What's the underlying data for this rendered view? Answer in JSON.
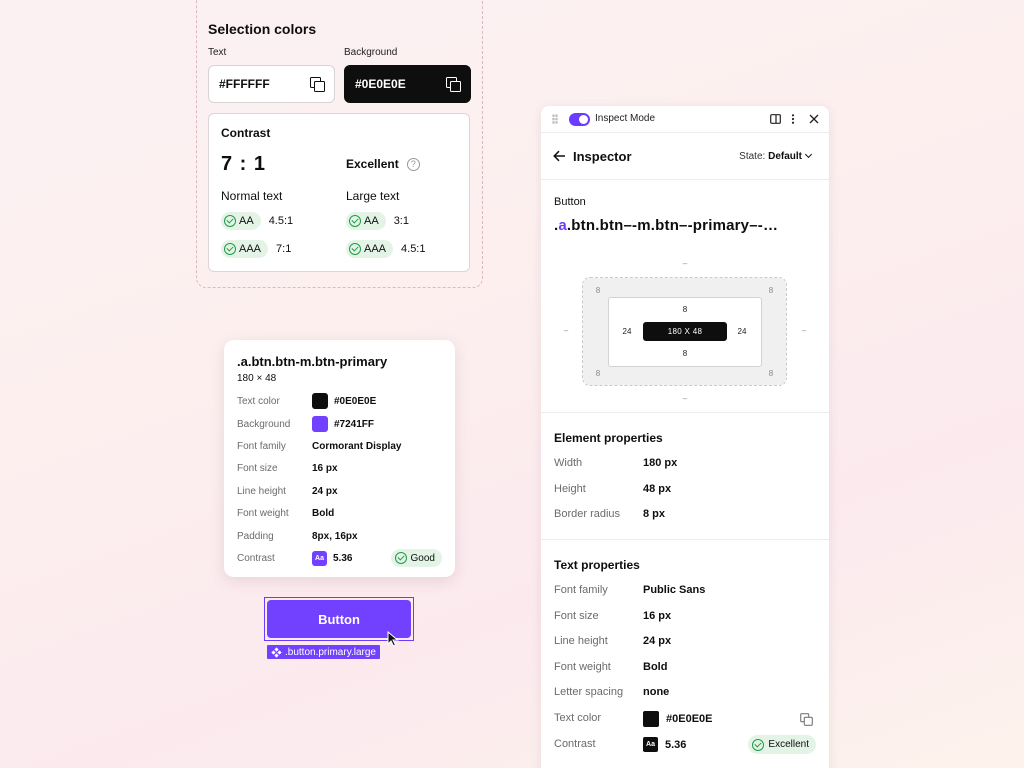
{
  "selection_colors": {
    "title": "Selection colors",
    "text_label": "Text",
    "text_value": "#FFFFFF",
    "background_label": "Background",
    "background_value": "#0E0E0E"
  },
  "contrast": {
    "title": "Contrast",
    "ratio": "7 : 1",
    "rating": "Excellent",
    "help_glyph": "?",
    "normal_label": "Normal text",
    "large_label": "Large text",
    "normal": [
      {
        "level": "AA",
        "value": "4.5:1"
      },
      {
        "level": "AAA",
        "value": "7:1"
      }
    ],
    "large": [
      {
        "level": "AA",
        "value": "3:1"
      },
      {
        "level": "AAA",
        "value": "4.5:1"
      }
    ]
  },
  "tooltip": {
    "selector": ".a.btn.btn-m.btn-primary",
    "size": "180 × 48",
    "rows": [
      {
        "key": "Text color",
        "value": "#0E0E0E"
      },
      {
        "key": "Background",
        "value": "#7241FF"
      },
      {
        "key": "Font family",
        "value": "Cormorant Display"
      },
      {
        "key": "Font size",
        "value": "16 px"
      },
      {
        "key": "Line height",
        "value": "24 px"
      },
      {
        "key": "Font weight",
        "value": "Bold"
      },
      {
        "key": "Padding",
        "value": "8px, 16px"
      },
      {
        "key": "Contrast",
        "value": "5.36"
      }
    ],
    "aa_glyph": "Aa",
    "contrast_badge": "Good",
    "colors": {
      "text": "#0E0E0E",
      "background": "#7241FF"
    }
  },
  "preview": {
    "button_label": "Button",
    "component_tag": ".button.primary.large"
  },
  "inspector": {
    "mode_label": "Inspect Mode",
    "title": "Inspector",
    "state_label": "State:",
    "state_value": "Default",
    "element_kind": "Button",
    "element_class_prefix": ".",
    "element_class_a": "a",
    "element_class_rest": ".btn.btn–-m.btn–-primary–-…",
    "box_model": {
      "margin": {
        "top": "–",
        "right": "–",
        "bottom": "–",
        "left": "–"
      },
      "corners": {
        "tl": "8",
        "tr": "8",
        "bl": "8",
        "br": "8"
      },
      "padding": {
        "top": "8",
        "right": "24",
        "bottom": "8",
        "left": "24"
      },
      "content": "180 X 48"
    },
    "element_properties": {
      "title": "Element properties",
      "rows": [
        {
          "key": "Width",
          "value": "180 px"
        },
        {
          "key": "Height",
          "value": "48 px"
        },
        {
          "key": "Border radius",
          "value": "8 px"
        }
      ]
    },
    "text_properties": {
      "title": "Text properties",
      "rows": [
        {
          "key": "Font family",
          "value": "Public Sans"
        },
        {
          "key": "Font size",
          "value": "16 px"
        },
        {
          "key": "Line height",
          "value": "24 px"
        },
        {
          "key": "Font weight",
          "value": "Bold"
        },
        {
          "key": "Letter spacing",
          "value": "none"
        }
      ],
      "text_color_key": "Text color",
      "text_color_value": "#0E0E0E",
      "contrast_key": "Contrast",
      "contrast_value": "5.36",
      "aa_glyph": "Aa",
      "contrast_badge": "Excellent"
    }
  },
  "theme": {
    "accent": "#7241FF",
    "success": "#1F9A47",
    "dark": "#0E0E0E"
  }
}
